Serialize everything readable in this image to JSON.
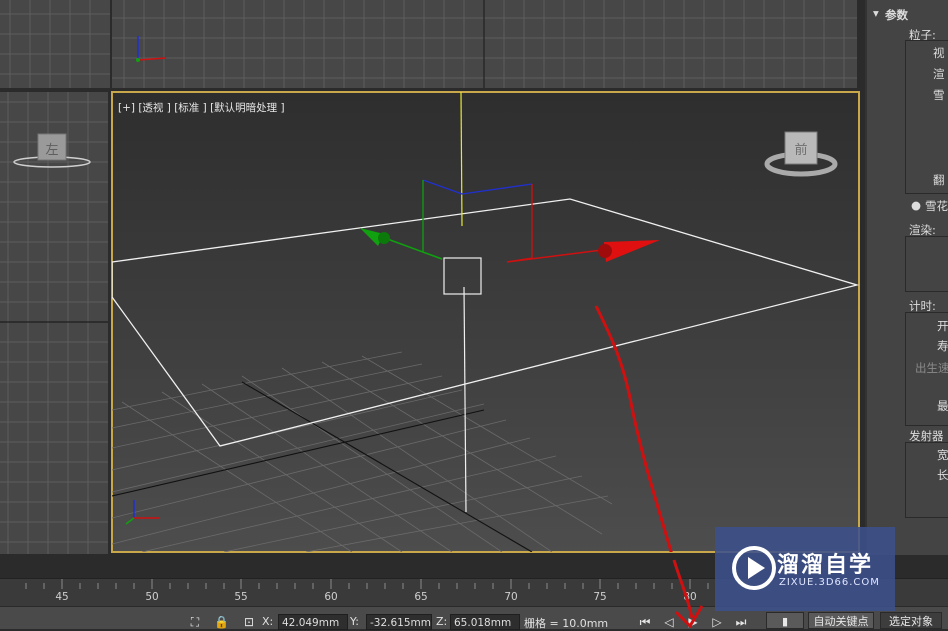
{
  "viewport": {
    "label": "[+] [透视 ] [标准 ] [默认明暗处理 ]",
    "cube_face": "前",
    "left_cube_face": "左"
  },
  "panel": {
    "rollout_title": "参数",
    "items": [
      {
        "text": "粒子:"
      },
      {
        "text": "视"
      },
      {
        "text": "渲"
      },
      {
        "text": "雪"
      },
      {
        "text": "翻"
      },
      {
        "text": "雪花"
      },
      {
        "text": "渲染:"
      },
      {
        "text": "计时:"
      },
      {
        "text": "开"
      },
      {
        "text": "寿"
      },
      {
        "text": "出生速"
      },
      {
        "text": "最"
      },
      {
        "text": "发射器"
      },
      {
        "text": "宽"
      },
      {
        "text": "长"
      }
    ]
  },
  "timeline": {
    "ticks": [
      "45",
      "50",
      "55",
      "60",
      "65",
      "70",
      "75",
      "80"
    ]
  },
  "statusbar": {
    "x_label": "X:",
    "x_value": "42.049mm",
    "y_label": "Y:",
    "y_value": "-32.615mm",
    "z_label": "Z:",
    "z_value": "65.018mm",
    "grid_label": "栅格 = 10.0mm",
    "auto_key": "自动关键点",
    "selected": "选定对象"
  },
  "watermark": {
    "title": "溜溜自学",
    "subtitle": "ZIXUE.3D66.COM"
  },
  "colors": {
    "viewport_border": "#c8a84a",
    "annotation": "#d01010",
    "axis_x": "#d01010",
    "axis_y": "#10a010",
    "axis_z": "#2030d0",
    "watermark_bg": "#3c508c"
  }
}
